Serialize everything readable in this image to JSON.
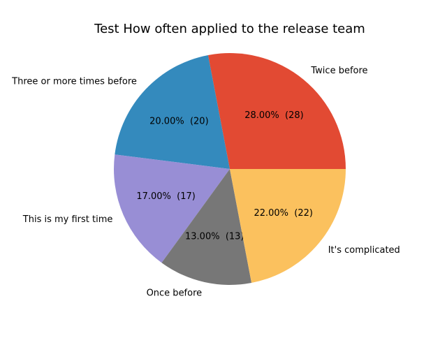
{
  "chart_data": {
    "type": "pie",
    "title": "Test How often applied to the release team",
    "slices": [
      {
        "label": "Twice before",
        "value": 28,
        "percent_label": "28.00%  (28)",
        "color": "#E24A33"
      },
      {
        "label": "Three or more times before",
        "value": 20,
        "percent_label": "20.00%  (20)",
        "color": "#348ABD"
      },
      {
        "label": "This is my first time",
        "value": 17,
        "percent_label": "17.00%  (17)",
        "color": "#988ED5"
      },
      {
        "label": "Once before",
        "value": 13,
        "percent_label": "13.00%  (13)",
        "color": "#777777"
      },
      {
        "label": "It's complicated",
        "value": 22,
        "percent_label": "22.00%  (22)",
        "color": "#FBC15E"
      }
    ],
    "start_angle_deg": 0,
    "direction": "counterclockwise",
    "legend": "none"
  }
}
